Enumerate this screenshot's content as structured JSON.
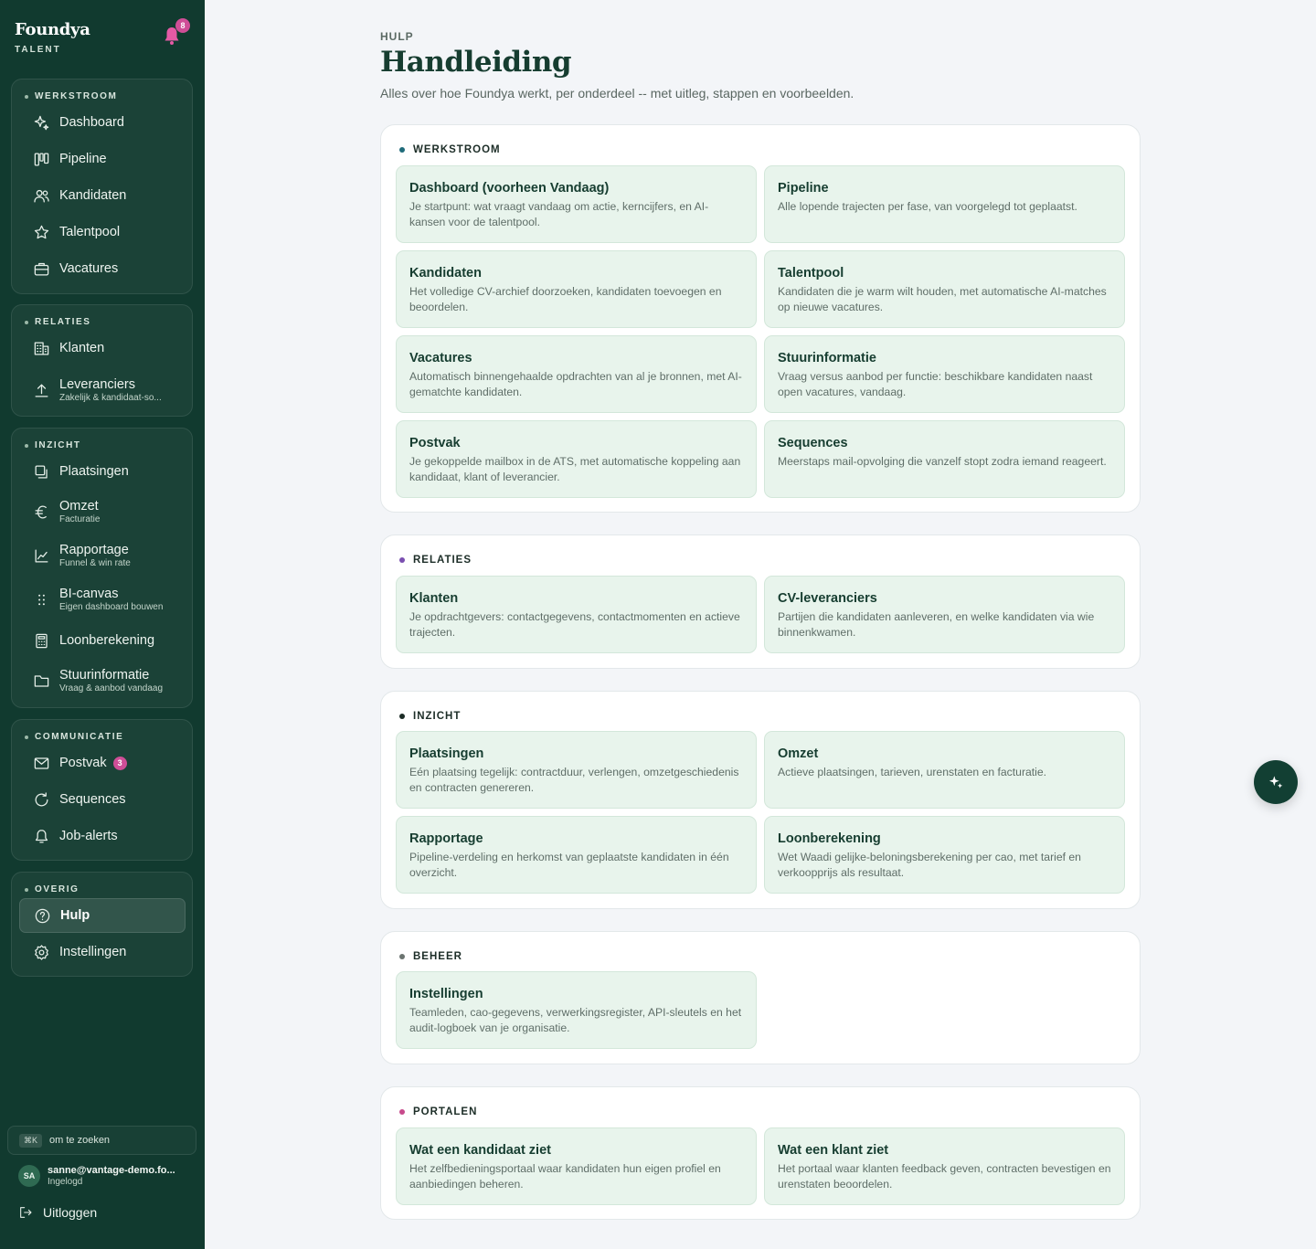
{
  "brand": {
    "name": "Foundya",
    "sub": "TALENT",
    "notifications": "8"
  },
  "sidebar": {
    "groups": [
      {
        "label": "WERKSTROOM",
        "items": [
          {
            "label": "Dashboard",
            "icon": "sparkle-icon"
          },
          {
            "label": "Pipeline",
            "icon": "kanban-icon"
          },
          {
            "label": "Kandidaten",
            "icon": "users-icon"
          },
          {
            "label": "Talentpool",
            "icon": "star-icon"
          },
          {
            "label": "Vacatures",
            "icon": "briefcase-icon"
          }
        ]
      },
      {
        "label": "RELATIES",
        "items": [
          {
            "label": "Klanten",
            "icon": "building-icon"
          },
          {
            "label": "Leveranciers",
            "sub": "Zakelijk & kandidaat-so...",
            "icon": "upload-icon"
          }
        ]
      },
      {
        "label": "INZICHT",
        "items": [
          {
            "label": "Plaatsingen",
            "icon": "copy-icon"
          },
          {
            "label": "Omzet",
            "sub": "Facturatie",
            "icon": "euro-icon"
          },
          {
            "label": "Rapportage",
            "sub": "Funnel & win rate",
            "icon": "chart-line-icon"
          },
          {
            "label": "BI-canvas",
            "sub": "Eigen dashboard bouwen",
            "icon": "grid-dots-icon"
          },
          {
            "label": "Loonberekening",
            "icon": "calculator-icon"
          },
          {
            "label": "Stuurinformatie",
            "sub": "Vraag & aanbod vandaag",
            "icon": "folder-icon"
          }
        ]
      },
      {
        "label": "COMMUNICATIE",
        "items": [
          {
            "label": "Postvak",
            "badge": "3",
            "icon": "mail-icon"
          },
          {
            "label": "Sequences",
            "icon": "refresh-icon"
          },
          {
            "label": "Job-alerts",
            "icon": "bell-icon"
          }
        ]
      },
      {
        "label": "OVERIG",
        "items": [
          {
            "label": "Hulp",
            "icon": "help-circle-icon",
            "active": true
          },
          {
            "label": "Instellingen",
            "icon": "settings-icon"
          }
        ]
      }
    ],
    "search": {
      "kbd": "⌘K",
      "text": "om te zoeken"
    },
    "user": {
      "initials": "SA",
      "email": "sanne@vantage-demo.fo...",
      "status": "Ingelogd"
    },
    "logout": "Uitloggen"
  },
  "main": {
    "eyebrow": "HULP",
    "title": "Handleiding",
    "subtitle": "Alles over hoe Foundya werkt, per onderdeel -- met uitleg, stappen en voorbeelden.",
    "sections": [
      {
        "label": "WERKSTROOM",
        "dot_color": "#1f6b7a",
        "cards": [
          {
            "title": "Dashboard (voorheen Vandaag)",
            "desc": "Je startpunt: wat vraagt vandaag om actie, kerncijfers, en AI-kansen voor de talentpool."
          },
          {
            "title": "Pipeline",
            "desc": "Alle lopende trajecten per fase, van voorgelegd tot geplaatst."
          },
          {
            "title": "Kandidaten",
            "desc": "Het volledige CV-archief doorzoeken, kandidaten toevoegen en beoordelen."
          },
          {
            "title": "Talentpool",
            "desc": "Kandidaten die je warm wilt houden, met automatische AI-matches op nieuwe vacatures."
          },
          {
            "title": "Vacatures",
            "desc": "Automatisch binnengehaalde opdrachten van al je bronnen, met AI-gematchte kandidaten."
          },
          {
            "title": "Stuurinformatie",
            "desc": "Vraag versus aanbod per functie: beschikbare kandidaten naast open vacatures, vandaag."
          },
          {
            "title": "Postvak",
            "desc": "Je gekoppelde mailbox in de ATS, met automatische koppeling aan kandidaat, klant of leverancier."
          },
          {
            "title": "Sequences",
            "desc": "Meerstaps mail-opvolging die vanzelf stopt zodra iemand reageert."
          }
        ]
      },
      {
        "label": "RELATIES",
        "dot_color": "#7a4fb0",
        "cards": [
          {
            "title": "Klanten",
            "desc": "Je opdrachtgevers: contactgegevens, contactmomenten en actieve trajecten."
          },
          {
            "title": "CV-leveranciers",
            "desc": "Partijen die kandidaten aanleveren, en welke kandidaten via wie binnenkwamen."
          }
        ]
      },
      {
        "label": "INZICHT",
        "dot_color": "#1b2b25",
        "cards": [
          {
            "title": "Plaatsingen",
            "desc": "Eén plaatsing tegelijk: contractduur, verlengen, omzetgeschiedenis en contracten genereren."
          },
          {
            "title": "Omzet",
            "desc": "Actieve plaatsingen, tarieven, urenstaten en facturatie."
          },
          {
            "title": "Rapportage",
            "desc": "Pipeline-verdeling en herkomst van geplaatste kandidaten in één overzicht."
          },
          {
            "title": "Loonberekening",
            "desc": "Wet Waadi gelijke-beloningsberekening per cao, met tarief en verkoopprijs als resultaat."
          }
        ]
      },
      {
        "label": "BEHEER",
        "dot_color": "#6b7470",
        "cards": [
          {
            "title": "Instellingen",
            "desc": "Teamleden, cao-gegevens, verwerkingsregister, API-sleutels en het audit-logboek van je organisatie."
          }
        ]
      },
      {
        "label": "PORTALEN",
        "dot_color": "#c74a8c",
        "cards": [
          {
            "title": "Wat een kandidaat ziet",
            "desc": "Het zelfbedieningsportaal waar kandidaten hun eigen profiel en aanbiedingen beheren."
          },
          {
            "title": "Wat een klant ziet",
            "desc": "Het portaal waar klanten feedback geven, contracten bevestigen en urenstaten beoordelen."
          }
        ]
      }
    ]
  },
  "fab": {
    "icon": "sparkle-icon"
  }
}
